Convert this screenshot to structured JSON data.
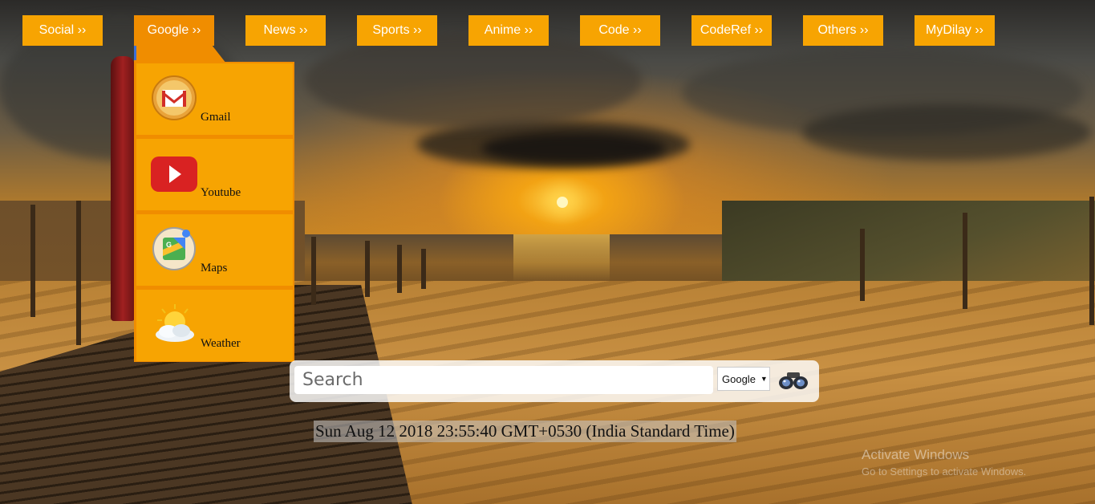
{
  "nav": {
    "items": [
      {
        "label": "Social ››"
      },
      {
        "label": "Google ››"
      },
      {
        "label": "News ››"
      },
      {
        "label": "Sports ››"
      },
      {
        "label": "Anime ››"
      },
      {
        "label": "Code ››"
      },
      {
        "label": "CodeRef ››"
      },
      {
        "label": "Others ››"
      },
      {
        "label": "MyDilay ››"
      }
    ],
    "active": "Google ››"
  },
  "dropdown": {
    "items": [
      {
        "label": "Gmail",
        "icon": "gmail-icon"
      },
      {
        "label": "Youtube",
        "icon": "youtube-icon"
      },
      {
        "label": "Maps",
        "icon": "maps-icon"
      },
      {
        "label": "Weather",
        "icon": "weather-icon"
      }
    ]
  },
  "search": {
    "placeholder": "Search",
    "value": "",
    "engine": "Google",
    "submit_icon": "binoculars-icon"
  },
  "clock": {
    "text": "Sun Aug 12 2018 23:55:40 GMT+0530 (India Standard Time)"
  },
  "watermark": {
    "title": "Activate Windows",
    "subtitle": "Go to Settings to activate Windows."
  },
  "colors": {
    "nav_bg": "#f7a402",
    "nav_active": "#f08d00",
    "nav_text": "#ffffff"
  }
}
